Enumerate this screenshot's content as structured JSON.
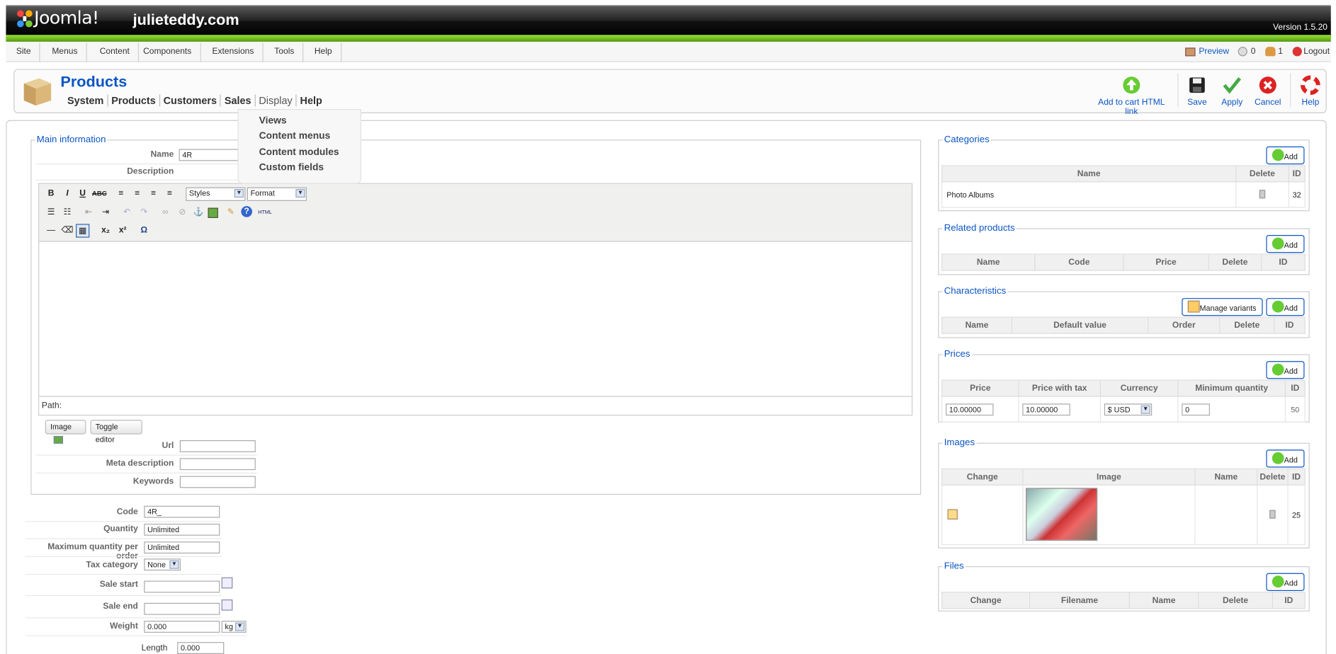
{
  "header": {
    "logo_text": "Joomla!",
    "site_name": "julieteddy.com",
    "version": "Version 1.5.20"
  },
  "menu": {
    "items": [
      "Site",
      "Menus",
      "Content",
      "Components",
      "Extensions",
      "Tools",
      "Help"
    ]
  },
  "status": {
    "preview": "Preview",
    "messages": "0",
    "users": "1",
    "logout": "Logout"
  },
  "page": {
    "title": "Products",
    "submenu": [
      "System",
      "Products",
      "Customers",
      "Sales",
      "Display",
      "Help"
    ]
  },
  "display_dropdown": [
    "Views",
    "Content menus",
    "Content modules",
    "Custom fields"
  ],
  "toolbar": {
    "add_to_cart": "Add to cart HTML link",
    "save": "Save",
    "apply": "Apply",
    "cancel": "Cancel",
    "help": "Help"
  },
  "main_info": {
    "legend": "Main information",
    "name_label": "Name",
    "name_value": "4R",
    "description_label": "Description",
    "styles": "Styles",
    "format": "Format",
    "path_label": "Path:",
    "image_button": "Image",
    "toggle_editor_button": "Toggle editor",
    "url_label": "Url",
    "meta_description_label": "Meta description",
    "keywords_label": "Keywords"
  },
  "details": {
    "code_label": "Code",
    "code_value": "4R_",
    "quantity_label": "Quantity",
    "quantity_value": "Unlimited",
    "max_qty_label": "Maximum quantity per order",
    "max_qty_value": "Unlimited",
    "tax_label": "Tax category",
    "tax_value": "None",
    "sale_start_label": "Sale start",
    "sale_end_label": "Sale end",
    "weight_label": "Weight",
    "weight_value": "0.000",
    "weight_unit": "kg",
    "length_label": "Length",
    "length_value": "0.000"
  },
  "categories": {
    "legend": "Categories",
    "add": "Add",
    "headers": [
      "Name",
      "Delete",
      "ID"
    ],
    "row": {
      "name": "Photo Albums",
      "id": "32"
    }
  },
  "related": {
    "legend": "Related products",
    "add": "Add",
    "headers": [
      "Name",
      "Code",
      "Price",
      "Delete",
      "ID"
    ]
  },
  "characteristics": {
    "legend": "Characteristics",
    "manage_variants": "Manage variants",
    "add": "Add",
    "headers": [
      "Name",
      "Default value",
      "Order",
      "Delete",
      "ID"
    ]
  },
  "prices": {
    "legend": "Prices",
    "add": "Add",
    "headers": [
      "Price",
      "Price with tax",
      "Currency",
      "Minimum quantity",
      "ID"
    ],
    "row": {
      "price": "10.00000",
      "price_tax": "10.00000",
      "currency": "$ USD",
      "min_qty": "0",
      "id": "50"
    }
  },
  "images": {
    "legend": "Images",
    "add": "Add",
    "headers": [
      "Change",
      "Image",
      "Name",
      "Delete",
      "ID"
    ],
    "row": {
      "id": "25"
    }
  },
  "files": {
    "legend": "Files",
    "add": "Add",
    "headers": [
      "Change",
      "Filename",
      "Name",
      "Delete",
      "ID"
    ]
  }
}
